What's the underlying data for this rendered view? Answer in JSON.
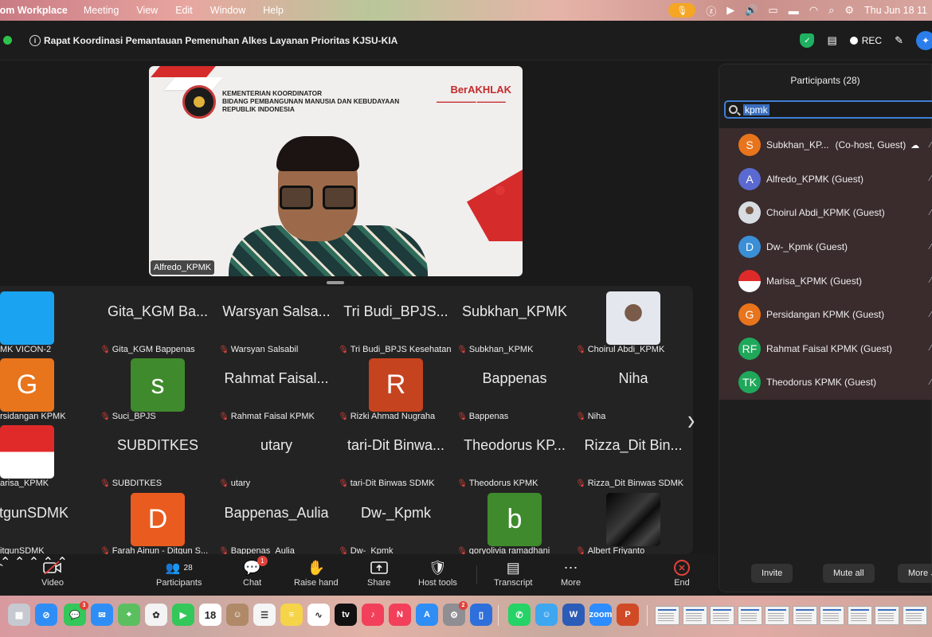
{
  "menubar": {
    "app_name": "oom Workplace",
    "items": [
      "Meeting",
      "View",
      "Edit",
      "Window",
      "Help"
    ],
    "clock": "Thu Jun 18  11"
  },
  "meeting": {
    "title": "Rapat Koordinasi Pemantauan Pemenuhan Alkes Layanan Prioritas KJSU-KIA",
    "rec_label": "REC"
  },
  "speaker": {
    "name": "Alfredo_KPMK",
    "slide_ministry": [
      "KEMENTERIAN KOORDINATOR",
      "BIDANG PEMBANGUNAN MANUSIA DAN KEBUDAYAAN",
      "REPUBLIK INDONESIA"
    ],
    "slide_brand": "BerAKHLAK"
  },
  "gallery": [
    {
      "big": "",
      "initial": "",
      "label": "MK VICON-2",
      "muted": false,
      "color": "#1aa3f0"
    },
    {
      "big": "Gita_KGM Ba...",
      "initial": "",
      "label": "Gita_KGM Bappenas",
      "muted": true,
      "color": ""
    },
    {
      "big": "Warsyan Salsa...",
      "initial": "",
      "label": "Warsyan Salsabil",
      "muted": true,
      "color": ""
    },
    {
      "big": "Tri Budi_BPJS...",
      "initial": "",
      "label": "Tri Budi_BPJS Kesehatan",
      "muted": true,
      "color": ""
    },
    {
      "big": "Subkhan_KPMK",
      "initial": "",
      "label": "Subkhan_KPMK",
      "muted": true,
      "color": ""
    },
    {
      "big": "",
      "initial": "",
      "label": "Choirul Abdi_KPMK",
      "muted": true,
      "color": "#8aa0b4"
    },
    {
      "big": "",
      "initial": "G",
      "label": "rsidangan KPMK",
      "muted": false,
      "color": "#e8741c"
    },
    {
      "big": "",
      "initial": "s",
      "label": "Suci_BPJS",
      "muted": true,
      "color": "#3f8a2c"
    },
    {
      "big": "Rahmat Faisal...",
      "initial": "",
      "label": "Rahmat Faisal KPMK",
      "muted": true,
      "color": ""
    },
    {
      "big": "",
      "initial": "R",
      "label": "Rizki Ahmad Nugraha",
      "muted": true,
      "color": "#c6431f"
    },
    {
      "big": "Bappenas",
      "initial": "",
      "label": "Bappenas",
      "muted": true,
      "color": ""
    },
    {
      "big": "Niha",
      "initial": "",
      "label": "Niha",
      "muted": true,
      "color": ""
    },
    {
      "big": "",
      "initial": "",
      "label": "arisa_KPMK",
      "muted": false,
      "color": "#e02a2a"
    },
    {
      "big": "SUBDITKES",
      "initial": "",
      "label": "SUBDITKES",
      "muted": true,
      "color": ""
    },
    {
      "big": "utary",
      "initial": "",
      "label": "utary",
      "muted": true,
      "color": ""
    },
    {
      "big": "tari-Dit Binwa...",
      "initial": "",
      "label": "tari-Dit Binwas SDMK",
      "muted": true,
      "color": ""
    },
    {
      "big": "Theodorus KP...",
      "initial": "",
      "label": "Theodorus KPMK",
      "muted": true,
      "color": ""
    },
    {
      "big": "Rizza_Dit Bin...",
      "initial": "",
      "label": "Rizza_Dit Binwas SDMK",
      "muted": true,
      "color": ""
    },
    {
      "big": "DitgunSDMK",
      "initial": "",
      "label": "itgunSDMK",
      "muted": false,
      "color": ""
    },
    {
      "big": "",
      "initial": "D",
      "label": "Farah Ainun - Ditgun S...",
      "muted": true,
      "color": "#ea5b1f"
    },
    {
      "big": "Bappenas_Aulia",
      "initial": "",
      "label": "Bappenas_Aulia",
      "muted": true,
      "color": ""
    },
    {
      "big": "Dw-_Kpmk",
      "initial": "",
      "label": "Dw-_Kpmk",
      "muted": true,
      "color": ""
    },
    {
      "big": "",
      "initial": "b",
      "label": "qoryolivia ramadhani",
      "muted": true,
      "color": "#3f8a2c"
    },
    {
      "big": "",
      "initial": "",
      "label": "Albert Friyanto",
      "muted": true,
      "color": "#111111"
    }
  ],
  "toolbar": {
    "video_label": "Video",
    "participants_label": "Participants",
    "participants_count": "28",
    "chat_label": "Chat",
    "chat_badge": "1",
    "raise_hand_label": "Raise hand",
    "share_label": "Share",
    "host_tools_label": "Host tools",
    "transcript_label": "Transcript",
    "more_label": "More",
    "end_label": "End"
  },
  "panel": {
    "title": "Participants (28)",
    "search_value": "kpmk",
    "participants": [
      {
        "initials": "S",
        "name": "Subkhan_KP...",
        "suffix": "(Co-host, Guest)",
        "color": "#e8741c"
      },
      {
        "initials": "A",
        "name": "Alfredo_KPMK (Guest)",
        "suffix": "",
        "color": "#5a6ad0"
      },
      {
        "initials": "",
        "name": "Choirul Abdi_KPMK (Guest)",
        "suffix": "",
        "color": "#8aa0b4"
      },
      {
        "initials": "D",
        "name": "Dw-_Kpmk (Guest)",
        "suffix": "",
        "color": "#3a8fd6"
      },
      {
        "initials": "",
        "name": "Marisa_KPMK (Guest)",
        "suffix": "",
        "color": "#e02a2a"
      },
      {
        "initials": "G",
        "name": "Persidangan KPMK (Guest)",
        "suffix": "",
        "color": "#e8741c"
      },
      {
        "initials": "RF",
        "name": "Rahmat Faisal KPMK (Guest)",
        "suffix": "",
        "color": "#1fa85a"
      },
      {
        "initials": "TK",
        "name": "Theodorus KPMK (Guest)",
        "suffix": "",
        "color": "#1fa85a"
      }
    ],
    "invite_label": "Invite",
    "mute_all_label": "Mute all",
    "more_label": "More"
  },
  "dock": {
    "calendar_day": "18",
    "messages_badge": "3",
    "settings_badge": "2"
  }
}
